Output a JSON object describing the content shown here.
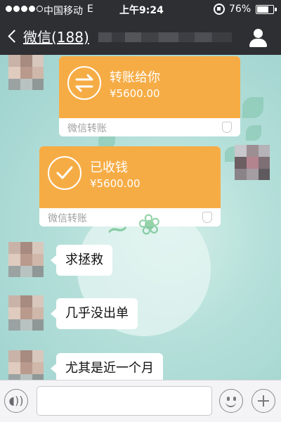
{
  "status_bar": {
    "carrier": "中国移动",
    "network": "E",
    "time": "上午9:24",
    "battery": "76%",
    "battery_level": 0.76,
    "signal_bars_filled": 4,
    "signal_bars_total": 5
  },
  "nav": {
    "back_label": "微信(188)",
    "title": "",
    "profile_icon": "person-icon"
  },
  "messages": {
    "transfer_sent": {
      "title": "转账给你",
      "amount": "¥5600.00",
      "footer": "微信转账",
      "icon": "transfer-arrows-icon"
    },
    "transfer_received": {
      "title": "已收钱",
      "amount": "¥5600.00",
      "footer": "微信转账",
      "icon": "checkmark-icon"
    },
    "text_1": "求拯救",
    "text_2": "几乎没出单",
    "text_3": "尤其是近一个月"
  },
  "input": {
    "placeholder": "",
    "voice_icon": "voice-icon",
    "emoji_icon": "emoji-icon",
    "more_icon": "plus-icon"
  },
  "colors": {
    "bar": "#2e2f33",
    "transfer_orange": "#f6ac45",
    "chat_bg": "#b6e0da"
  }
}
